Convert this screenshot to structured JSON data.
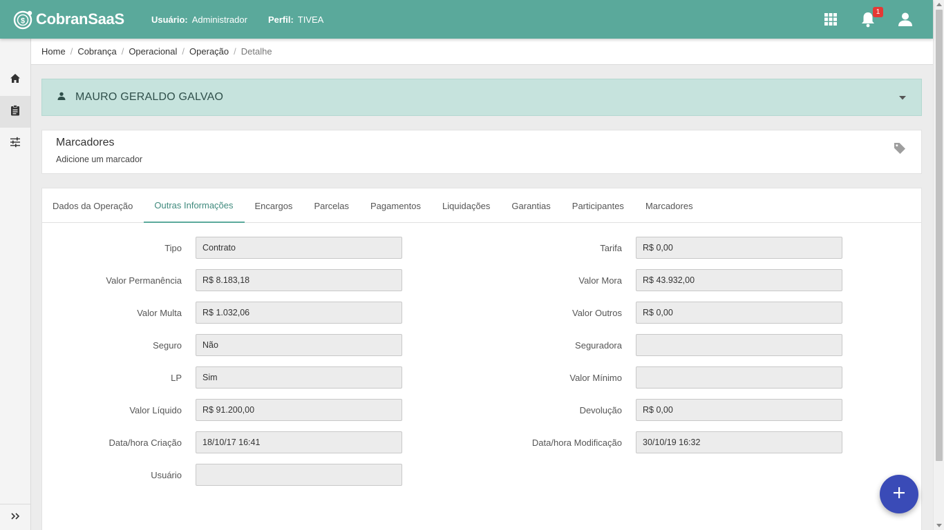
{
  "header": {
    "logo_text": "CobranSaaS",
    "user_label": "Usuário:",
    "user_value": "Administrador",
    "profile_label": "Perfil:",
    "profile_value": "TIVEA",
    "notification_count": "1",
    "icons": [
      "apps-grid-icon",
      "bell-icon",
      "account-icon"
    ]
  },
  "sidebar": {
    "items": [
      {
        "icon": "home-icon"
      },
      {
        "icon": "clipboard-icon"
      },
      {
        "icon": "sliders-icon"
      }
    ],
    "expand_icon": "double-chevron-right-icon"
  },
  "breadcrumb": {
    "items": [
      "Home",
      "Cobrança",
      "Operacional",
      "Operação"
    ],
    "current": "Detalhe"
  },
  "person": {
    "name": "MAURO GERALDO GALVAO"
  },
  "tags": {
    "title": "Marcadores",
    "subtitle": "Adicione um marcador"
  },
  "tabs": [
    {
      "label": "Dados da Operação"
    },
    {
      "label": "Outras Informações",
      "active": true
    },
    {
      "label": "Encargos"
    },
    {
      "label": "Parcelas"
    },
    {
      "label": "Pagamentos"
    },
    {
      "label": "Liquidações"
    },
    {
      "label": "Garantias"
    },
    {
      "label": "Participantes"
    },
    {
      "label": "Marcadores"
    }
  ],
  "form": {
    "left": [
      {
        "label": "Tipo",
        "value": "Contrato"
      },
      {
        "label": "Valor Permanência",
        "value": "R$ 8.183,18"
      },
      {
        "label": "Valor Multa",
        "value": "R$ 1.032,06"
      },
      {
        "label": "Seguro",
        "value": "Não"
      },
      {
        "label": "LP",
        "value": "Sim"
      },
      {
        "label": "Valor Líquido",
        "value": "R$ 91.200,00"
      },
      {
        "label": "Data/hora Criação",
        "value": "18/10/17 16:41"
      },
      {
        "label": "Usuário",
        "value": ""
      }
    ],
    "right": [
      {
        "label": "Tarifa",
        "value": "R$ 0,00"
      },
      {
        "label": "Valor Mora",
        "value": "R$ 43.932,00"
      },
      {
        "label": "Valor Outros",
        "value": "R$ 0,00"
      },
      {
        "label": "Seguradora",
        "value": ""
      },
      {
        "label": "Valor Mínimo",
        "value": ""
      },
      {
        "label": "Devolução",
        "value": "R$ 0,00"
      },
      {
        "label": "Data/hora Modificação",
        "value": "30/10/19 16:32"
      }
    ]
  },
  "colors": {
    "primary": "#5aa99b",
    "person_bg": "#c6e3dd",
    "fab": "#3a4bb7",
    "badge": "#e53935"
  }
}
